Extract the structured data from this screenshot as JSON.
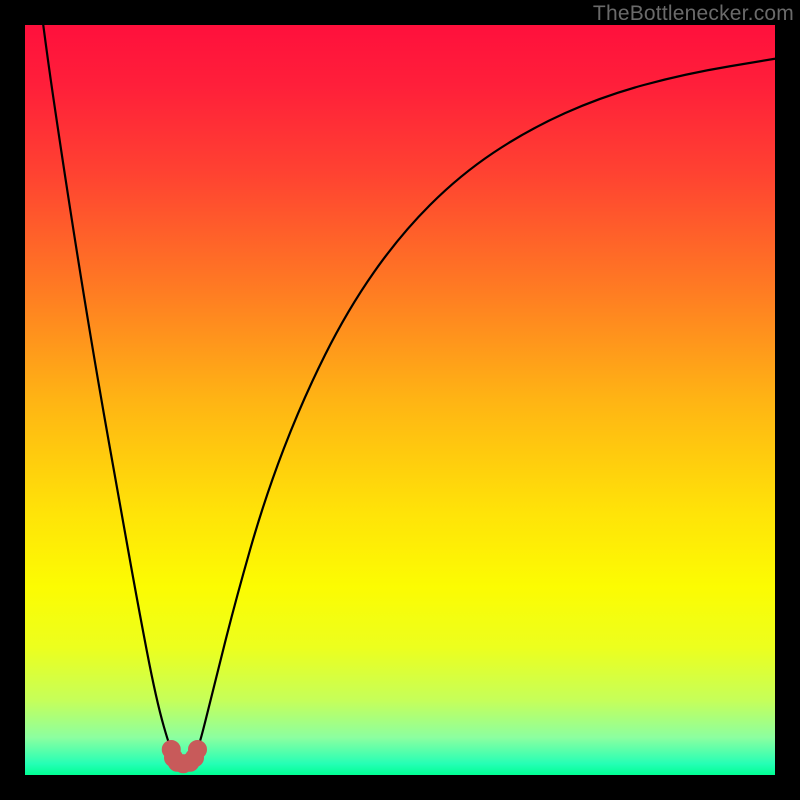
{
  "watermark": {
    "text": "TheBottlenecker.com"
  },
  "gradient": {
    "stops": [
      {
        "offset": 0.0,
        "color": "#ff103c"
      },
      {
        "offset": 0.08,
        "color": "#ff1f3a"
      },
      {
        "offset": 0.2,
        "color": "#ff4331"
      },
      {
        "offset": 0.35,
        "color": "#ff7a23"
      },
      {
        "offset": 0.5,
        "color": "#ffb414"
      },
      {
        "offset": 0.65,
        "color": "#ffe308"
      },
      {
        "offset": 0.75,
        "color": "#fcfc02"
      },
      {
        "offset": 0.83,
        "color": "#ecff1e"
      },
      {
        "offset": 0.9,
        "color": "#c6ff59"
      },
      {
        "offset": 0.95,
        "color": "#8cffa0"
      },
      {
        "offset": 0.985,
        "color": "#25ffb5"
      },
      {
        "offset": 1.0,
        "color": "#00ff93"
      }
    ]
  },
  "marker": {
    "fill": "#c85a5a",
    "stroke": "#c85a5a",
    "points": [
      {
        "x": 0.195,
        "y": 0.966
      },
      {
        "x": 0.198,
        "y": 0.977
      },
      {
        "x": 0.203,
        "y": 0.983
      },
      {
        "x": 0.211,
        "y": 0.985
      },
      {
        "x": 0.22,
        "y": 0.983
      },
      {
        "x": 0.226,
        "y": 0.977
      },
      {
        "x": 0.23,
        "y": 0.966
      }
    ],
    "radius": 9
  },
  "chart_data": {
    "type": "line",
    "title": "",
    "xlabel": "",
    "ylabel": "",
    "xlim": [
      0,
      1
    ],
    "ylim": [
      0,
      1
    ],
    "note": "Axes are unlabeled in the image; x and y are normalized 0–1. y represents bottleneck severity (0 = none/green, 1 = max/red). The curve dips to ~0 near x≈0.21.",
    "series": [
      {
        "name": "bottleneck-curve",
        "x": [
          0.0,
          0.025,
          0.05,
          0.075,
          0.1,
          0.125,
          0.15,
          0.175,
          0.195,
          0.205,
          0.213,
          0.22,
          0.23,
          0.25,
          0.28,
          0.32,
          0.37,
          0.43,
          0.5,
          0.58,
          0.67,
          0.77,
          0.88,
          1.0
        ],
        "y": [
          1.2,
          0.99,
          0.82,
          0.66,
          0.51,
          0.37,
          0.23,
          0.1,
          0.03,
          0.015,
          0.012,
          0.015,
          0.03,
          0.11,
          0.23,
          0.37,
          0.5,
          0.62,
          0.72,
          0.8,
          0.86,
          0.905,
          0.935,
          0.955
        ]
      }
    ]
  }
}
